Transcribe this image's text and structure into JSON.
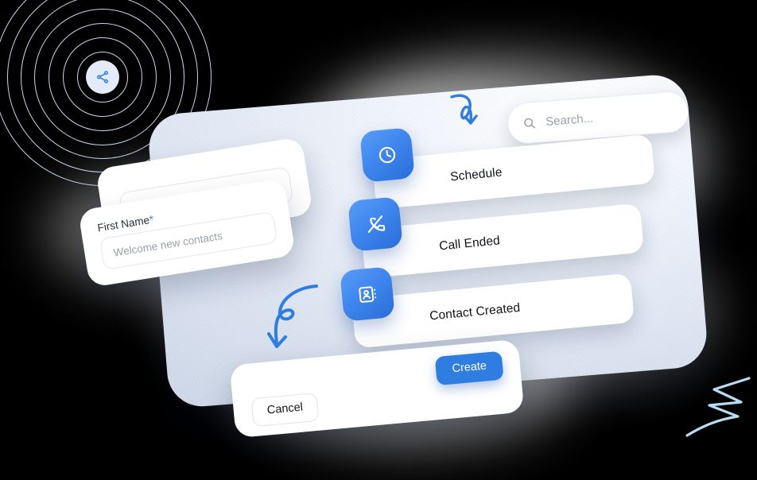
{
  "theme": {
    "background": "#000000",
    "panel_surface": "#e3ebf7",
    "card_surface": "#ffffff",
    "accent_blue": "#2f7de1",
    "tile_gradient_from": "#5a9cf5",
    "tile_gradient_to": "#2a6ed6",
    "ring_stroke": "#c9d4ec",
    "required_marker": "#3b82f6",
    "text_primary": "#10131a",
    "text_muted": "#9aa0ab"
  },
  "decor": {
    "rings_icon": "share-nodes-icon",
    "ring_count": 7,
    "arrow_top": "curved-arrow-down-icon",
    "arrow_middle": "looping-arrow-down-icon",
    "squiggle": "zigzag-squiggle-icon"
  },
  "search": {
    "icon": "search-icon",
    "placeholder": "Search...",
    "value": ""
  },
  "activity_list": {
    "items": [
      {
        "label": "Schedule",
        "icon": "clock-icon"
      },
      {
        "label": "Call Ended",
        "icon": "phone-off-icon"
      },
      {
        "label": "Contact Created",
        "icon": "contact-card-icon"
      }
    ]
  },
  "form": {
    "first_name": {
      "label": "First Name",
      "required_marker": "*",
      "placeholder": "Welcome new contacts",
      "value": ""
    }
  },
  "actions": {
    "cancel_label": "Cancel",
    "create_label": "Create"
  }
}
